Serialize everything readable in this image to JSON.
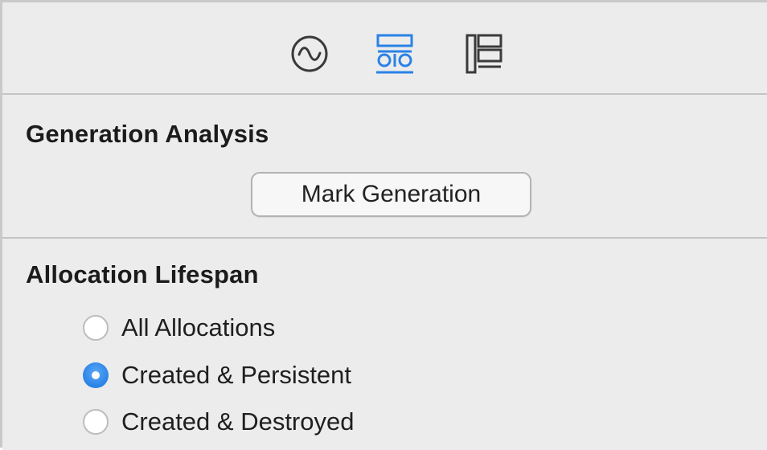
{
  "toolbar": {
    "icons": [
      {
        "name": "activity-monitor-icon",
        "selected": false
      },
      {
        "name": "generation-settings-icon",
        "selected": true
      },
      {
        "name": "call-tree-icon",
        "selected": false
      }
    ],
    "accent_color": "#2a82e6"
  },
  "generation": {
    "title": "Generation Analysis",
    "button_label": "Mark Generation"
  },
  "allocation": {
    "title": "Allocation Lifespan",
    "options": [
      {
        "label": "All Allocations",
        "checked": false
      },
      {
        "label": "Created & Persistent",
        "checked": true
      },
      {
        "label": "Created & Destroyed",
        "checked": false
      }
    ]
  }
}
